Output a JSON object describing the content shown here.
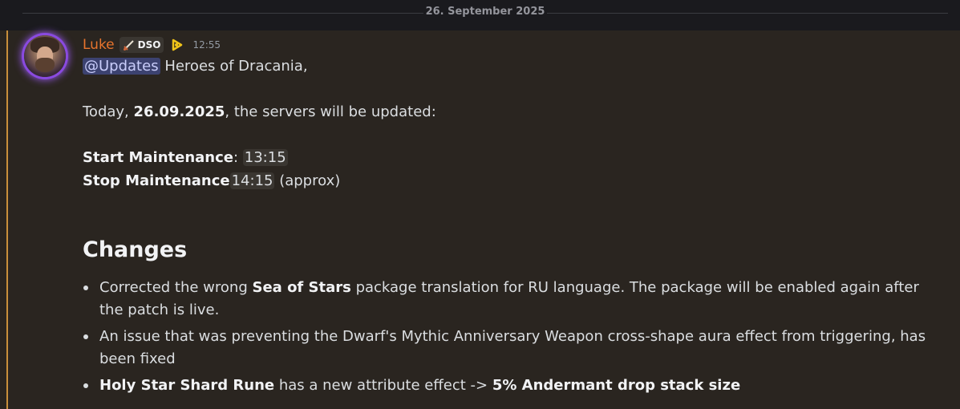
{
  "date_divider": "26. September 2025",
  "message": {
    "author": "Luke",
    "guild_tag": "DSO",
    "guild_icon": "sword-icon",
    "badge_icon": "nitro-icon",
    "time": "12:55",
    "mention": "@Updates",
    "greeting": "Heroes of Dracania,",
    "today_prefix": "Today, ",
    "today_date": "26.09.2025",
    "today_suffix": ", the servers will be updated:",
    "start_label": "Start Maintenance",
    "start_sep": ": ",
    "start_time": "13:15",
    "stop_label": "Stop Maintenance",
    "stop_time": "14:15",
    "stop_suffix": " (approx)",
    "changes_heading": "Changes",
    "changes": {
      "item1_pre": "Corrected the wrong ",
      "item1_bold": "Sea of Stars",
      "item1_post": " package translation for RU language. The package will be enabled again after the patch is live.",
      "item2": "An issue that was preventing the Dwarf's Mythic Anniversary Weapon cross-shape aura effect from triggering, has been fixed",
      "item3_bold": "Holy Star Shard Rune",
      "item3_mid": " has a new attribute effect -> ",
      "item3_bold2": "5% Andermant drop stack size"
    }
  },
  "colors": {
    "accent": "#c98f3b",
    "username": "#e8742d",
    "mention_bg": "#3c4270"
  }
}
